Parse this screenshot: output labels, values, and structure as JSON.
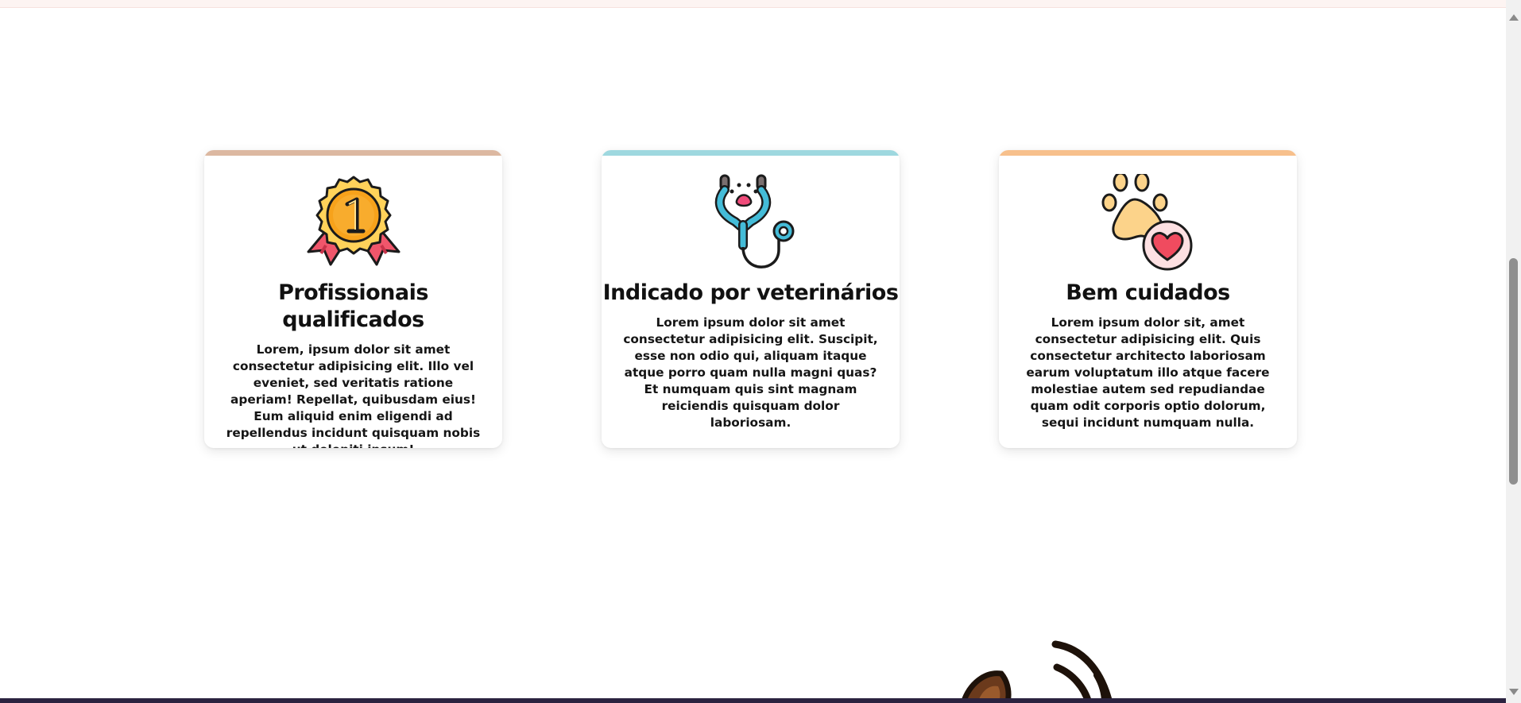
{
  "cards": [
    {
      "title": "Profissionais qualificados",
      "text": "Lorem, ipsum dolor sit amet consectetur adipisicing elit. Illo vel eveniet, sed veritatis ratione aperiam! Repellat, quibusdam eius! Eum aliquid enim eligendi ad repellendus incidunt quisquam nobis ut deleniti ipsum!",
      "icon": "medal-icon",
      "accent": "#dcb8a1"
    },
    {
      "title": "Indicado por veterinários",
      "text": "Lorem ipsum dolor sit amet consectetur adipisicing elit. Suscipit, esse non odio qui, aliquam itaque atque porro quam nulla magni quas? Et numquam quis sint magnam reiciendis quisquam dolor laboriosam.",
      "icon": "stethoscope-icon",
      "accent": "#9ed8df"
    },
    {
      "title": "Bem cuidados",
      "text": "Lorem ipsum dolor sit, amet consectetur adipisicing elit. Quis consectetur architecto laboriosam earum voluptatum illo atque facere molestiae autem sed repudiandae quam odit corporis optio dolorum, sequi incidunt numquam nulla.",
      "icon": "paw-heart-icon",
      "accent": "#f7c08c"
    }
  ]
}
